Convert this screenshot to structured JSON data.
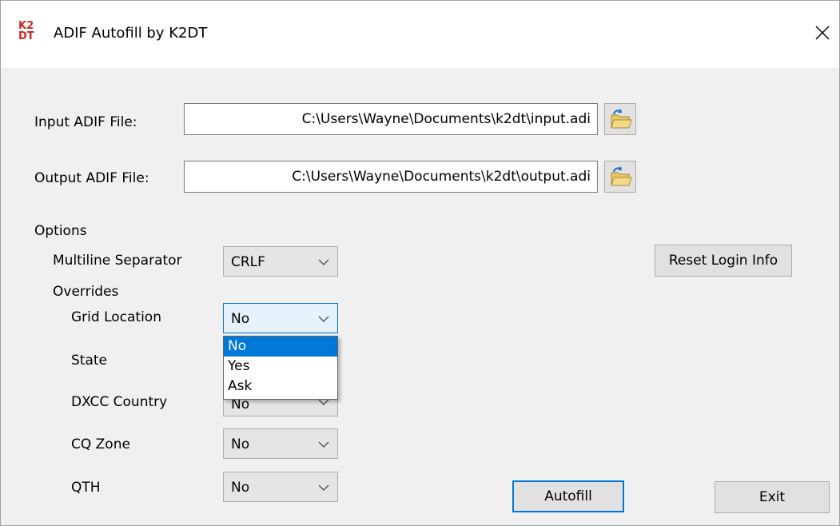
{
  "window": {
    "title": "ADIF Autofill by K2DT",
    "logo_text_top": "K2",
    "logo_text_bottom": "DT",
    "logo_color": "#c62828"
  },
  "files": {
    "input_label": "Input ADIF File:",
    "input_value": "C:\\Users\\Wayne\\Documents\\k2dt\\input.adi",
    "output_label": "Output ADIF File:",
    "output_value": "C:\\Users\\Wayne\\Documents\\k2dt\\output.adi",
    "browse_icon": "open-folder-icon"
  },
  "options": {
    "heading": "Options",
    "multiline_label": "Multiline Separator",
    "multiline_value": "CRLF",
    "overrides_label": "Overrides",
    "grid_label": "Grid Location",
    "grid_value": "No",
    "state_label": "State",
    "dxcc_label": "DXCC Country",
    "dxcc_value": "No",
    "cq_label": "CQ Zone",
    "cq_value": "No",
    "qth_label": "QTH",
    "qth_value": "No"
  },
  "dropdown": {
    "options": [
      "No",
      "Yes",
      "Ask"
    ],
    "selected": "No"
  },
  "buttons": {
    "reset_login": "Reset Login Info",
    "autofill": "Autofill",
    "exit": "Exit"
  },
  "colors": {
    "accent": "#0078d7",
    "window_bg": "#f0f0f0"
  }
}
